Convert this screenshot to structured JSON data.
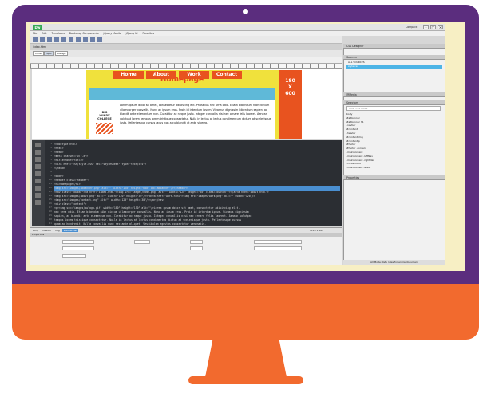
{
  "app": {
    "logo": "Dw",
    "workspace_label": "Compact"
  },
  "menu": [
    "File",
    "Edit",
    "Templates",
    "Bootstrap Components",
    "jQuery Mobile",
    "jQuery UI",
    "Favorites"
  ],
  "document_tab": "index.html",
  "view_buttons": [
    "Code",
    "Split",
    "Design"
  ],
  "page": {
    "heading": "Homepage",
    "ad_lines": [
      "180",
      "X",
      "600"
    ],
    "nav": [
      "Home",
      "About",
      "Work",
      "Contact"
    ],
    "logo_lines": [
      "BIG",
      "WINDY",
      "COLLEGE"
    ],
    "lorem": "Lorem ipsum dolor sit amet, consectetur adipiscing elit. Phasellus nec urna odio. Etiam bibendum nibh dictum ullamcorper convallis. Nunc ac ipsum eros. Proin id interdum ipsum. Vivamus dignissim bibendum sapien, ac blandit ante elementum non. Curabitur ac neque justo. Integer convallis nisi nec ornare felis laoreet. Aenean volutpat lorem tempus lorem tristique consectetur. Nulla in lectus at lectus condimentum dictum at scelerisque justo. Pellentesque cursus lacus non arcu blandit ut ante viverra."
  },
  "code_lines": [
    {
      "n": "1",
      "t": "<!doctype html>"
    },
    {
      "n": "2",
      "t": "<html>"
    },
    {
      "n": "3",
      "t": "<head>"
    },
    {
      "n": "4",
      "t": "<meta charset=\"UTF-8\">"
    },
    {
      "n": "5",
      "t": "<title>Home</title>"
    },
    {
      "n": "6",
      "t": "<link href=\"css/style.css\" rel=\"stylesheet\" type=\"text/css\">"
    },
    {
      "n": "7",
      "t": "</head>"
    },
    {
      "n": "8",
      "t": ""
    },
    {
      "n": "9",
      "t": "<body>"
    },
    {
      "n": "10",
      "t": "<header class=\"header\">"
    },
    {
      "n": "11",
      "t": "<h1>Homepage</h1>"
    },
    {
      "n": "12",
      "t": "<img src=\"images/adbanner.png\" alt=\"\" width=\"120\" height=\"600\" id=\"adbanner\"/></header>",
      "hl": true
    },
    {
      "n": "13",
      "t": "<nav class=\"navbar\"><a href=\"index.html\"><img src=\"images/home.png\" alt=\"\" width=\"120\" height=\"30\" class=\"button\"/></a><a href=\"about.html\">"
    },
    {
      "n": "14",
      "t": "<img src=\"images/about.png\" alt=\"\" width=\"120\" height=\"30\"/></a><a href=\"work.html\"><img src=\"images/work.png\" alt=\"\" width=\"120\"/>"
    },
    {
      "n": "15",
      "t": "<img src=\"images/contact.png\" alt=\"\" width=\"120\" height=\"30\"/></a></nav>"
    },
    {
      "n": "16",
      "t": "<div class=\"content\">"
    },
    {
      "n": "17",
      "t": "<p><img src=\"images/bwlogo.gif\" width=\"180\" height=\"150\" alt=\"\"/>Lorem ipsum dolor sit amet, consectetur adipiscing elit."
    },
    {
      "n": "18",
      "t": "nec urna odio. Etiam bibendum nibh dictum ullamcorper convallis. Nunc ac ipsum eros. Proin id interdum ipsum. Vivamus dignissim"
    },
    {
      "n": "19",
      "t": "sapien, ac blandit ante elementum non. Curabitur ac neque justo. Integer convallis nisi nec ornare felis laoreet. Aenean volutpat"
    },
    {
      "n": "20",
      "t": "tempus lorem tristique consectetur. Nulla in lectus at lectus condimentum dictum at scelerisque justo. Pellentesque cursus"
    },
    {
      "n": "21",
      "t": "quam ac hendrerit. Nulla convallis nunc nec ante aliquet. Vestibulum egestas consectetur venenatis."
    }
  ],
  "status": {
    "tags": [
      "body",
      "header",
      "img"
    ],
    "selected_tag": "#adbanner",
    "size": "1120 x 264"
  },
  "properties_title": "Properties",
  "right_panel": {
    "files_title": "CSS Designer",
    "sources_title": "Sources",
    "sources": [
      "ALL SOURCES",
      "style.css"
    ],
    "media_title": "@Media",
    "selectors_title": "Selectors",
    "filter_placeholder": "Filter CSS Rules",
    "selectors": [
      "body",
      "#adbanner",
      "#adbanner h1",
      ".navbar",
      "#content",
      ".header",
      "#content img",
      "#content p",
      "#footer",
      "#footer .content",
      ".mainContent",
      ".mainContent .leftNav",
      ".mainContent .rightNav",
      ".contentBox",
      ".mainContent .aside"
    ],
    "properties_title": "Properties",
    "footer": "All Mode: lists rules for entire document"
  }
}
